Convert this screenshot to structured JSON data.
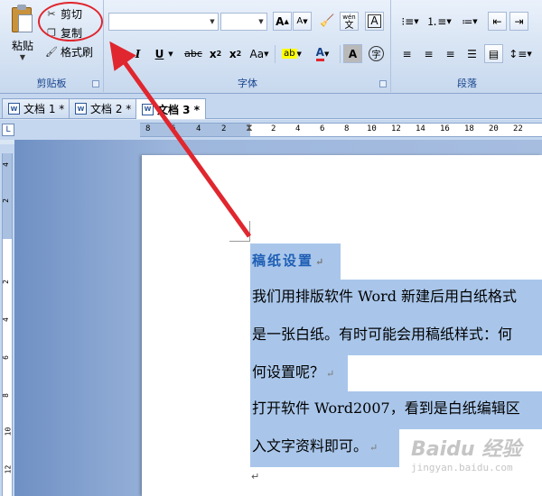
{
  "clipboard": {
    "group_label": "剪贴板",
    "paste_label": "粘贴",
    "cut_label": "剪切",
    "copy_label": "复制",
    "format_painter_label": "格式刷"
  },
  "font": {
    "group_label": "字体",
    "font_name": "",
    "font_size": "",
    "grow_label": "A",
    "shrink_label": "A",
    "phonetic_label": "wén",
    "phonetic_char": "文",
    "border_label": "A",
    "bold": "B",
    "italic": "I",
    "underline": "U",
    "strike": "abc",
    "subscript": "x",
    "subscript_suffix": "2",
    "superscript": "x",
    "superscript_suffix": "2",
    "case": "Aa",
    "font_color": "A",
    "shading": "A",
    "enclose": "字"
  },
  "paragraph": {
    "group_label": "段落"
  },
  "tabs": [
    {
      "label": "文档 1 *",
      "active": false
    },
    {
      "label": "文档 2 *",
      "active": false
    },
    {
      "label": "文档 3 *",
      "active": true
    }
  ],
  "ruler": {
    "tab_selector": "L",
    "ticks": [
      "8",
      "6",
      "4",
      "2",
      "2",
      "4",
      "6",
      "8",
      "10",
      "12",
      "14",
      "16",
      "18",
      "20",
      "22"
    ],
    "vticks": [
      "4",
      "2",
      "2",
      "4",
      "6",
      "8",
      "10",
      "12"
    ]
  },
  "document": {
    "lines": [
      "稿纸设置",
      "我们用排版软件 Word 新建后用白纸格式",
      "是一张白纸。有时可能会用稿纸样式：何",
      "何设置呢？",
      "打开软件 Word2007，看到是白纸编辑区",
      "入文字资料即可。"
    ],
    "para_mark": "↵"
  },
  "watermark": {
    "brand": "Baidu 经验",
    "url": "jingyan.baidu.com"
  },
  "colors": {
    "highlight_ring": "#e0262e",
    "selection": "#a9c6ea",
    "title_text": "#1f5fb4"
  }
}
